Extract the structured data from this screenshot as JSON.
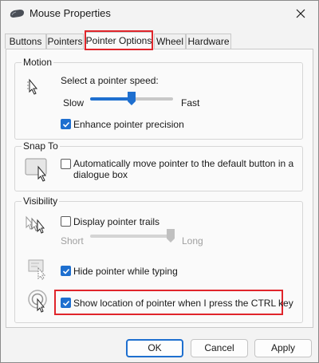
{
  "window": {
    "title": "Mouse Properties",
    "close_glyph": "close-icon"
  },
  "tabs": [
    {
      "label": "Buttons"
    },
    {
      "label": "Pointers"
    },
    {
      "label": "Pointer Options",
      "active": true
    },
    {
      "label": "Wheel"
    },
    {
      "label": "Hardware"
    }
  ],
  "motion": {
    "title": "Motion",
    "speed_label": "Select a pointer speed:",
    "slow_label": "Slow",
    "fast_label": "Fast",
    "speed_fraction": 0.5,
    "enhance_label": "Enhance pointer precision",
    "enhance_checked": true
  },
  "snap_to": {
    "title": "Snap To",
    "line1": "Automatically move pointer to the default button in a",
    "line2": "dialogue box",
    "checked": false
  },
  "visibility": {
    "title": "Visibility",
    "trails_label": "Display pointer trails",
    "trails_checked": false,
    "short_label": "Short",
    "long_label": "Long",
    "trails_fraction": 1.0,
    "hide_label": "Hide pointer while typing",
    "hide_checked": true,
    "ctrl_label": "Show location of pointer when I press the CTRL key",
    "ctrl_checked": true
  },
  "buttons": {
    "ok": "OK",
    "cancel": "Cancel",
    "apply": "Apply"
  },
  "colors": {
    "accent": "#1e6fcf",
    "highlight": "#e0252b"
  }
}
